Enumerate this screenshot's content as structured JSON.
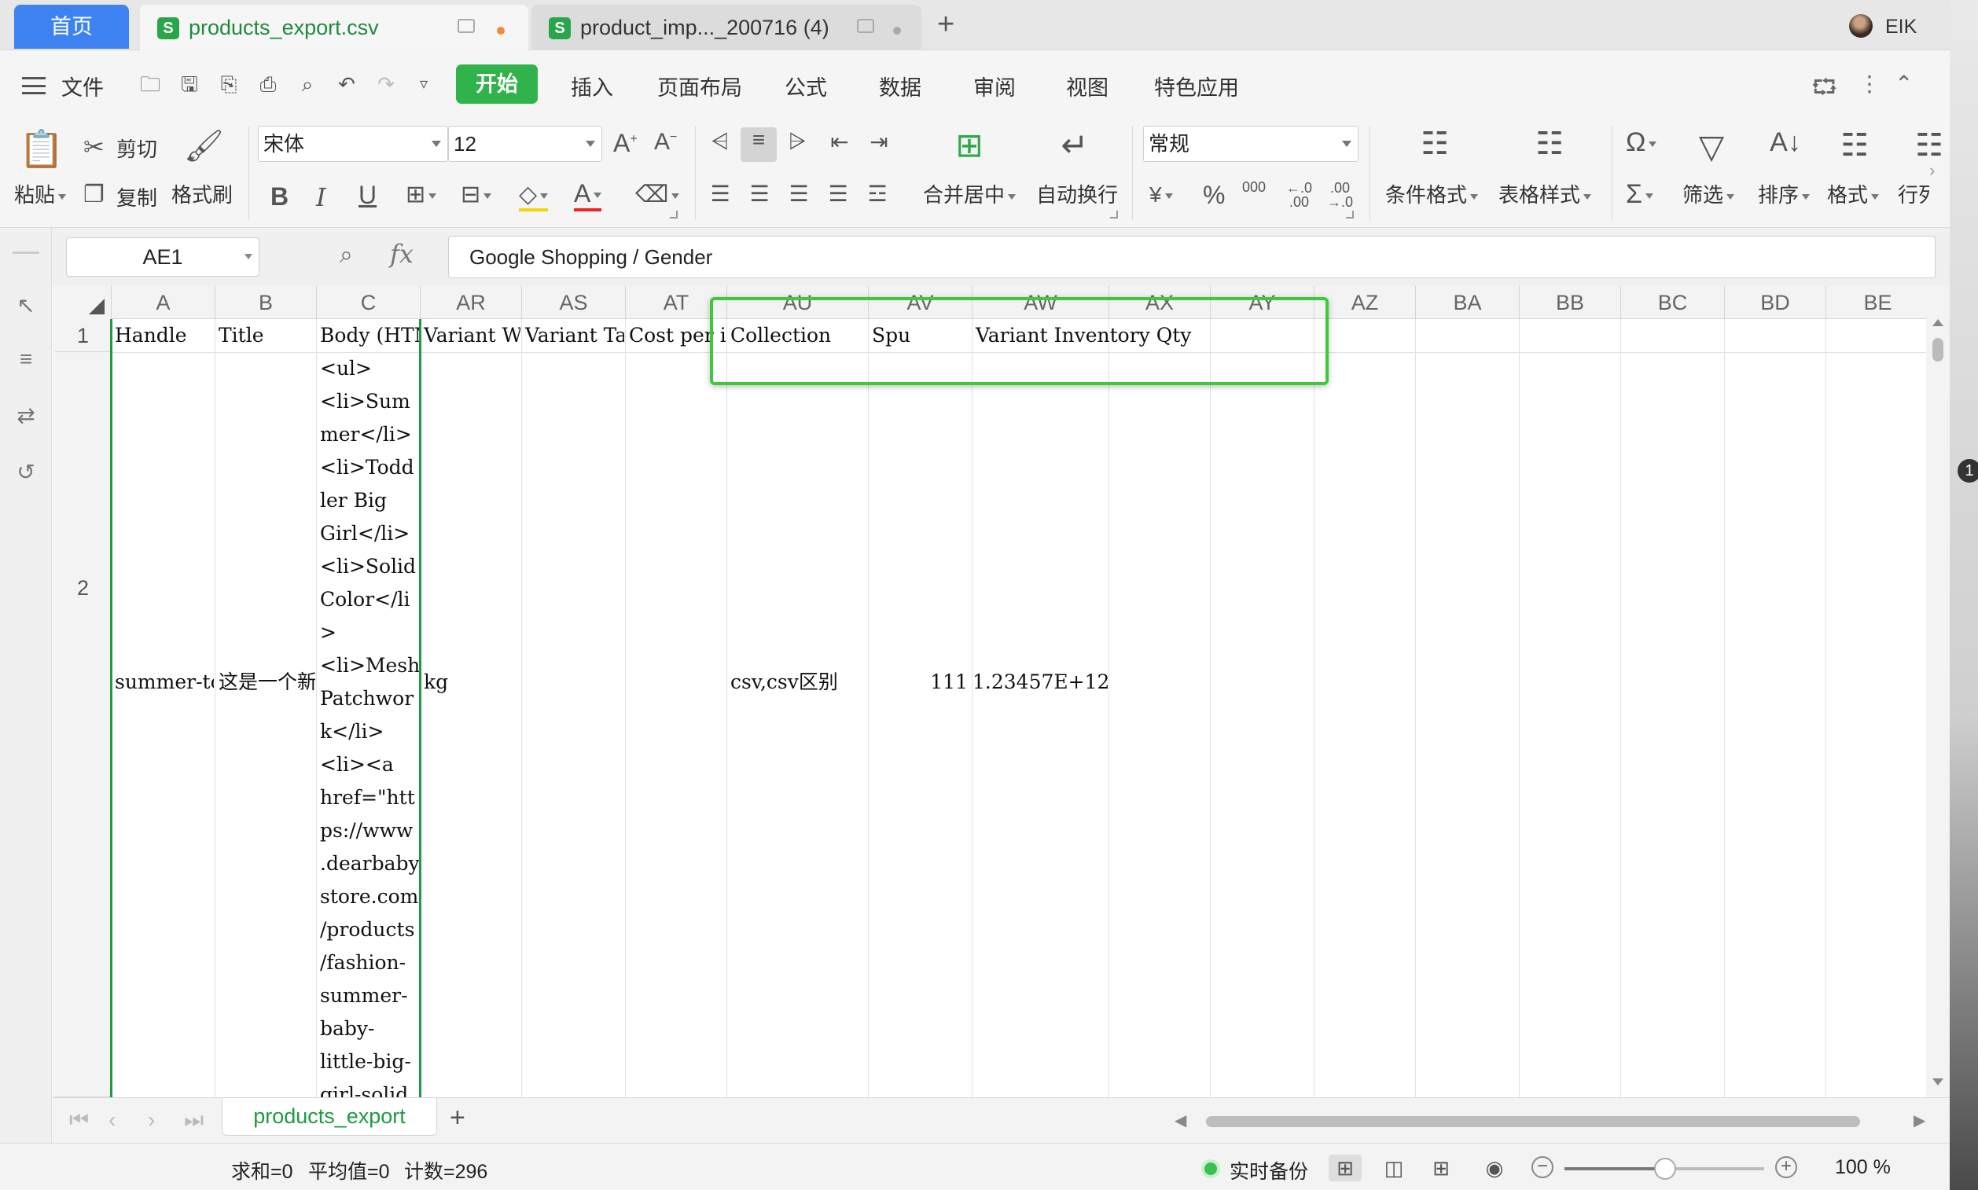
{
  "tabs": {
    "home": "首页",
    "doc1": "products_export.csv",
    "doc2": "product_imp..._200716 (4)",
    "new_tab": "+"
  },
  "user": {
    "name": "EIK"
  },
  "menu": {
    "file": "文件",
    "items": [
      "开始",
      "插入",
      "页面布局",
      "公式",
      "数据",
      "审阅",
      "视图",
      "特色应用"
    ]
  },
  "ribbon": {
    "paste": "粘贴",
    "cut": "剪切",
    "copy": "复制",
    "format_painter": "格式刷",
    "font_name": "宋体",
    "font_size": "12",
    "merge_center": "合并居中",
    "wrap_text": "自动换行",
    "number_format": "常规",
    "conditional_format": "条件格式",
    "table_style": "表格样式",
    "filter": "筛选",
    "sort": "排序",
    "format": "格式",
    "row_col": "行列",
    "percent": "%",
    "thousands": "000"
  },
  "formula_bar": {
    "cell_ref": "AE1",
    "fx": "fx",
    "content": "Google Shopping / Gender"
  },
  "grid": {
    "columns": [
      "A",
      "B",
      "C",
      "AR",
      "AS",
      "AT",
      "AU",
      "AV",
      "AW",
      "AX",
      "AY",
      "AZ",
      "BA",
      "BB",
      "BC",
      "BD",
      "BE"
    ],
    "rows": [
      "1",
      "2"
    ],
    "row1": {
      "A": "Handle",
      "B": "Title",
      "C": "Body (HTML)",
      "AR": "Variant Weight Unit",
      "AS": "Variant Tax Code",
      "AT": "Cost per item",
      "AU": "Collection",
      "AV": "Spu",
      "AW": "Variant Inventory Qty"
    },
    "row2": {
      "A": "summer-toddler",
      "B": "这是一个新",
      "C_lines": [
        "<ul>",
        "<li>Sum",
        "mer</li>",
        "<li>Todd",
        "ler Big",
        "Girl</li>",
        "<li>Solid",
        "Color</li",
        ">",
        "<li>Mesh",
        "Patchwor",
        "k</li>",
        "<li><a",
        "href=\"htt",
        "ps://www",
        ".dearbaby",
        "store.com",
        "/products",
        "/fashion-",
        "summer-",
        "baby-",
        "little-big-",
        "girl-solid"
      ],
      "AR": "kg",
      "AU": "csv,csv区别",
      "AV": "111",
      "AW": "1.23457E+12"
    }
  },
  "sheets": {
    "active": "products_export",
    "add": "+"
  },
  "status": {
    "sum": "求和=0",
    "average": "平均值=0",
    "count": "计数=296",
    "backup": "实时备份",
    "zoom": "100 %",
    "zoom_level": 0.5
  },
  "colors": {
    "accent_blue": "#3d82f0",
    "start_green": "#2fb34a",
    "selection_green": "#1e9a43",
    "highlight_box": "#3ec93a"
  },
  "icons": [
    "menu-icon",
    "open-icon",
    "save-icon",
    "print-icon",
    "undo-icon",
    "redo-icon",
    "share-icon",
    "more-icon",
    "collapse-icon"
  ]
}
